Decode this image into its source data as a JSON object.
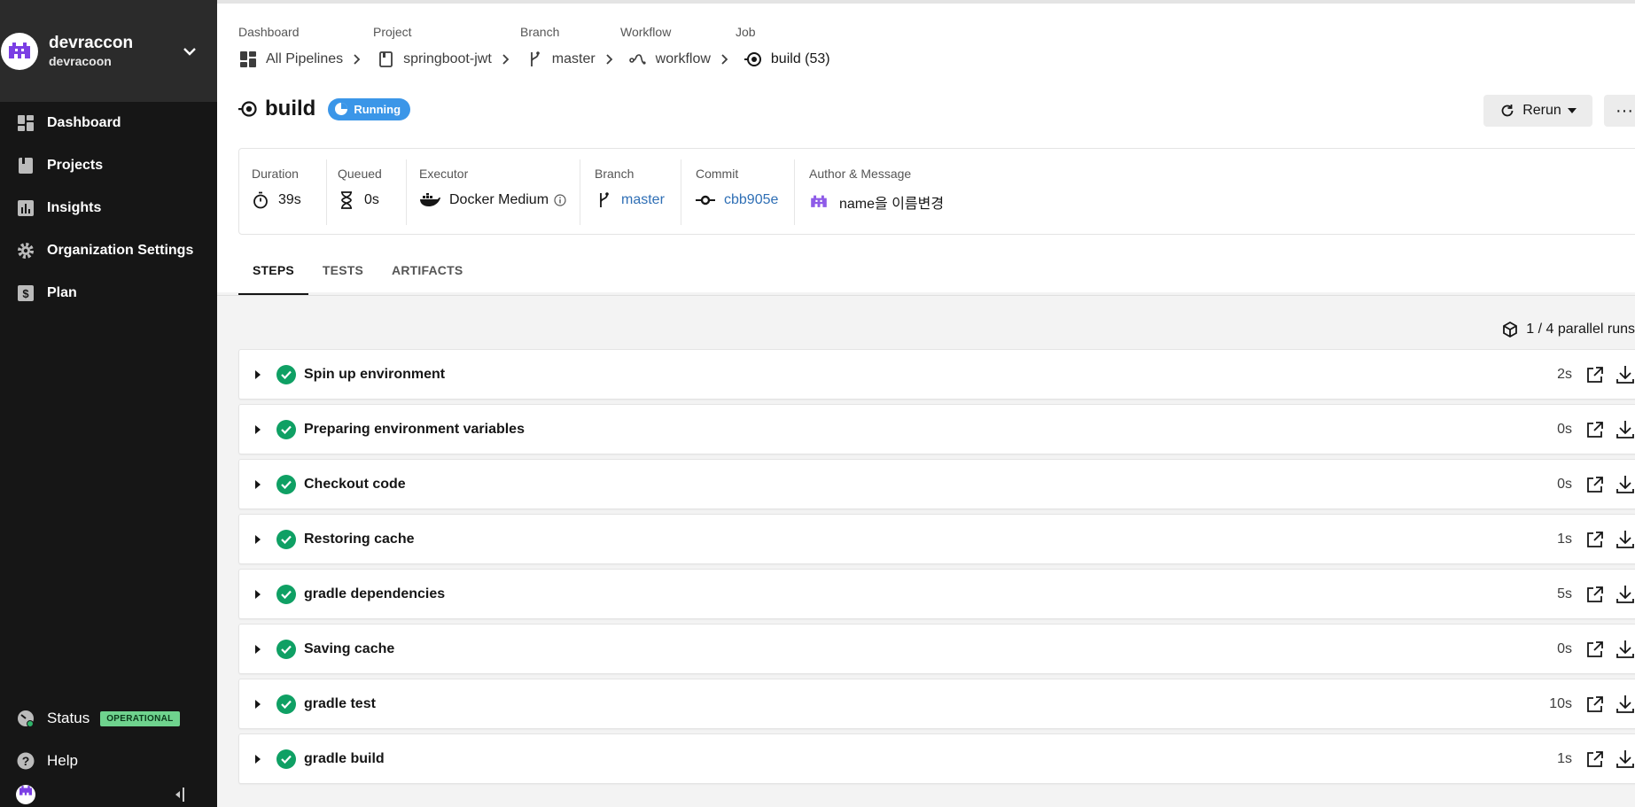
{
  "org": {
    "name": "devraccon",
    "subtitle": "devracoon"
  },
  "nav": [
    {
      "label": "Dashboard",
      "icon": "dashboard-icon"
    },
    {
      "label": "Projects",
      "icon": "projects-icon"
    },
    {
      "label": "Insights",
      "icon": "insights-icon"
    },
    {
      "label": "Organization Settings",
      "icon": "gear-icon"
    },
    {
      "label": "Plan",
      "icon": "plan-icon"
    }
  ],
  "status": {
    "label": "Status",
    "badge": "OPERATIONAL"
  },
  "help": {
    "label": "Help"
  },
  "breadcrumb": {
    "labels": [
      "Dashboard",
      "Project",
      "Branch",
      "Workflow",
      "Job"
    ],
    "items": [
      "All Pipelines",
      "springboot-jwt",
      "master",
      "workflow",
      "build (53)"
    ]
  },
  "job": {
    "title": "build",
    "status": "Running"
  },
  "actions": {
    "rerun": "Rerun",
    "more": "···"
  },
  "info": {
    "duration_label": "Duration",
    "duration": "39s",
    "queued_label": "Queued",
    "queued": "0s",
    "executor_label": "Executor",
    "executor": "Docker Medium",
    "branch_label": "Branch",
    "branch": "master",
    "commit_label": "Commit",
    "commit": "cbb905e",
    "author_label": "Author & Message",
    "message": "name을 이름변경"
  },
  "tabs": [
    "STEPS",
    "TESTS",
    "ARTIFACTS"
  ],
  "parallel": "1 / 4 parallel runs",
  "steps": [
    {
      "name": "Spin up environment",
      "duration": "2s"
    },
    {
      "name": "Preparing environment variables",
      "duration": "0s"
    },
    {
      "name": "Checkout code",
      "duration": "0s"
    },
    {
      "name": "Restoring cache",
      "duration": "1s"
    },
    {
      "name": "gradle dependencies",
      "duration": "5s"
    },
    {
      "name": "Saving cache",
      "duration": "0s"
    },
    {
      "name": "gradle test",
      "duration": "10s"
    },
    {
      "name": "gradle build",
      "duration": "1s"
    }
  ],
  "colors": {
    "sidebar": "#161616",
    "success": "#0fa064",
    "running": "#3b96e8",
    "link": "#2f6fb5",
    "operational": "#6fd38e"
  }
}
